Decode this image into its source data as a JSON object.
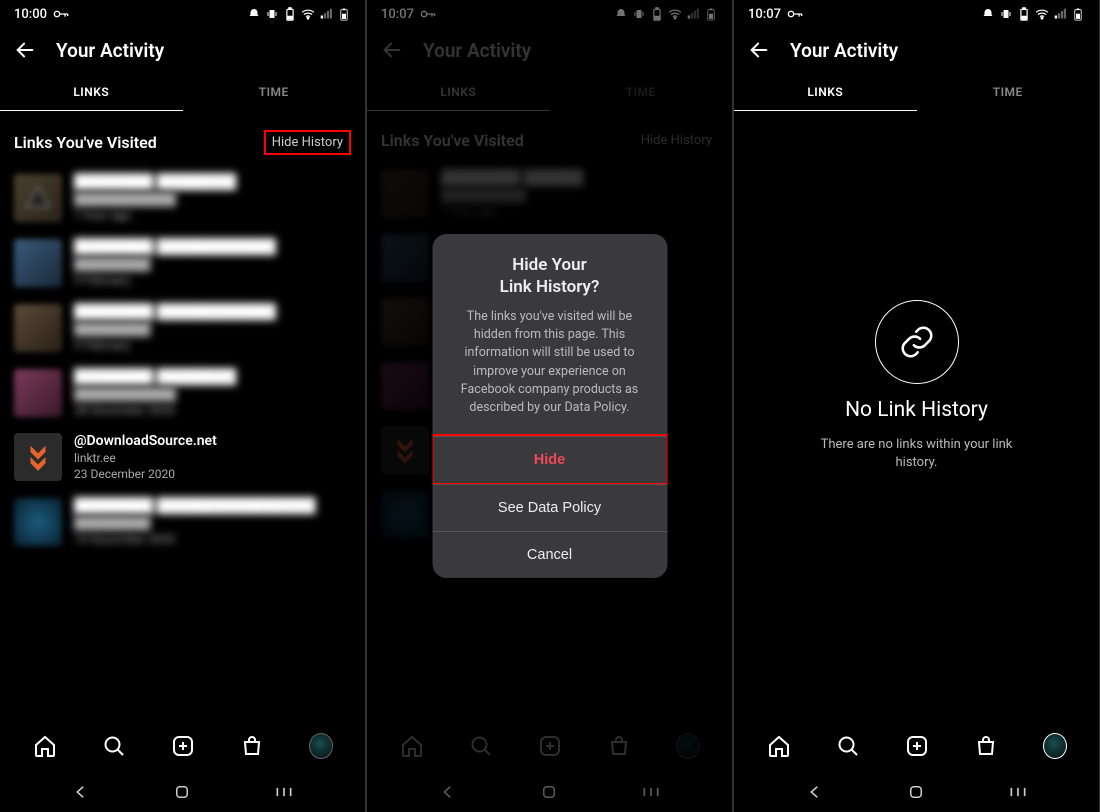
{
  "screen1": {
    "time": "10:00",
    "title": "Your Activity",
    "tabs": {
      "links": "LINKS",
      "time": "TIME"
    },
    "section_title": "Links You've Visited",
    "hide_history": "Hide History",
    "items": [
      {
        "title": "████████ ████████",
        "sub": "████████████",
        "date": "1 hour ago"
      },
      {
        "title": "████████ ████████████",
        "sub": "█████████",
        "date": "9 February"
      },
      {
        "title": "████████ ████████████",
        "sub": "█████████",
        "date": "9 February"
      },
      {
        "title": "████████ ████████",
        "sub": "████████████",
        "date": "28 December 2020"
      }
    ],
    "clear_item": {
      "title": "@DownloadSource.net",
      "sub": "linktr.ee",
      "date": "23 December 2020"
    },
    "trailing": {
      "title": "████████ ████████████████",
      "sub": "█████████",
      "date": "10 December 2020"
    }
  },
  "screen2": {
    "time": "10:07",
    "title": "Your Activity",
    "tabs": {
      "links": "LINKS",
      "time": "TIME"
    },
    "section_title": "Links You've Visited",
    "hide_history": "Hide History",
    "dialog": {
      "title_l1": "Hide Your",
      "title_l2": "Link History?",
      "body": "The links you've visited will be hidden from this page. This information will still be used to improve your experience on Facebook company products as described by our Data Policy.",
      "hide": "Hide",
      "policy": "See Data Policy",
      "cancel": "Cancel"
    }
  },
  "screen3": {
    "time": "10:07",
    "title": "Your Activity",
    "tabs": {
      "links": "LINKS",
      "time": "TIME"
    },
    "empty": {
      "title": "No Link History",
      "sub": "There are no links within your link history."
    }
  }
}
